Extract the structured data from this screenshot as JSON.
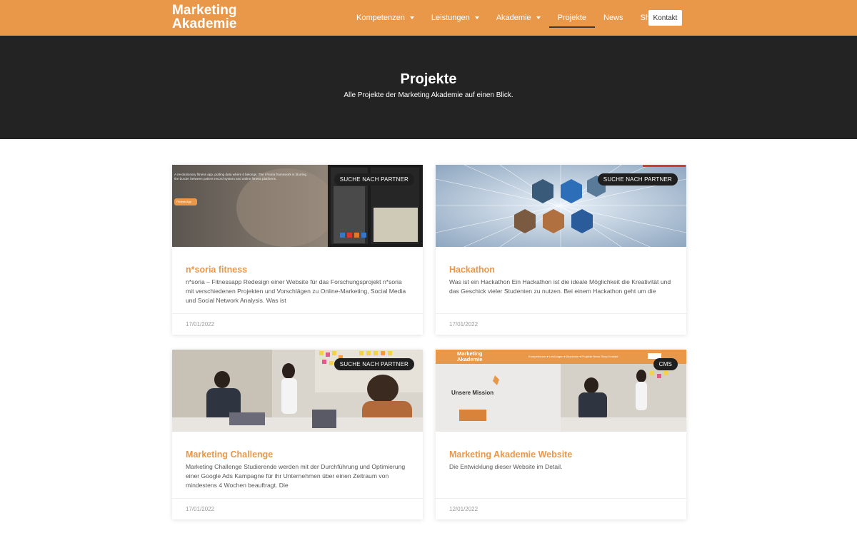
{
  "header": {
    "logo_line1": "Marketing",
    "logo_line2": "Akademie",
    "nav": [
      {
        "label": "Kompetenzen",
        "has_dropdown": true
      },
      {
        "label": "Leistungen",
        "has_dropdown": true
      },
      {
        "label": "Akademie",
        "has_dropdown": true
      },
      {
        "label": "Projekte",
        "active": true
      },
      {
        "label": "News"
      },
      {
        "label": "Shop"
      }
    ],
    "cta": "Kontakt"
  },
  "hero": {
    "title": "Projekte",
    "subtitle": "Alle Projekte der Marketing Akademie auf einen Blick."
  },
  "cards": [
    {
      "badge": "SUCHE NACH PARTNER",
      "title": "n*soria fitness",
      "excerpt": "n*soria – Fitnessapp Redesign einer Website für das Forschungsprojekt n*soria mit verschiedenen Projekten und Vorschlägen zu Online-Marketing, Social Media und Social Network Analysis. Was ist",
      "date": "17/01/2022"
    },
    {
      "badge": "SUCHE NACH PARTNER",
      "title": "Hackathon",
      "excerpt": "Was ist ein Hackathon Ein Hackathon ist die ideale Möglichkeit die Kreativität und das Geschick vieler Studenten zu nutzen. Bei einem Hackathon geht um die",
      "date": "17/01/2022"
    },
    {
      "badge": "SUCHE NACH PARTNER",
      "title": "Marketing Challenge",
      "excerpt": "Marketing Challenge Studierende werden mit der Durchführung und Optimierung einer Google Ads Kampagne für ihr Unternehmen über einen Zeitraum von mindestens 4 Wochen beauftragt.  Die",
      "date": "17/01/2022"
    },
    {
      "badge": "CMS",
      "title": "Marketing Akademie Website",
      "excerpt": "Die Entwicklung dieser Website im Detail.",
      "date": "12/01/2022"
    }
  ],
  "thumb_texts": {
    "fitness_blurb": "A revolutionary fitness app, putting data where it belongs. The n*soria framework is blurring the border between patient record system and online fitness platforms.",
    "fitness_button": "Fitness App",
    "site_logo1": "Marketing",
    "site_logo2": "Akademie",
    "site_mission": "Unsere Mission",
    "site_nav": "Kompetenzen ▾   Leistungen ▾   Akademie ▾   Projekte   News   Shop   Kontakt"
  },
  "colors": {
    "accent": "#e9984a",
    "hero_bg": "#232323",
    "badge_bg": "#1f1f1f"
  }
}
